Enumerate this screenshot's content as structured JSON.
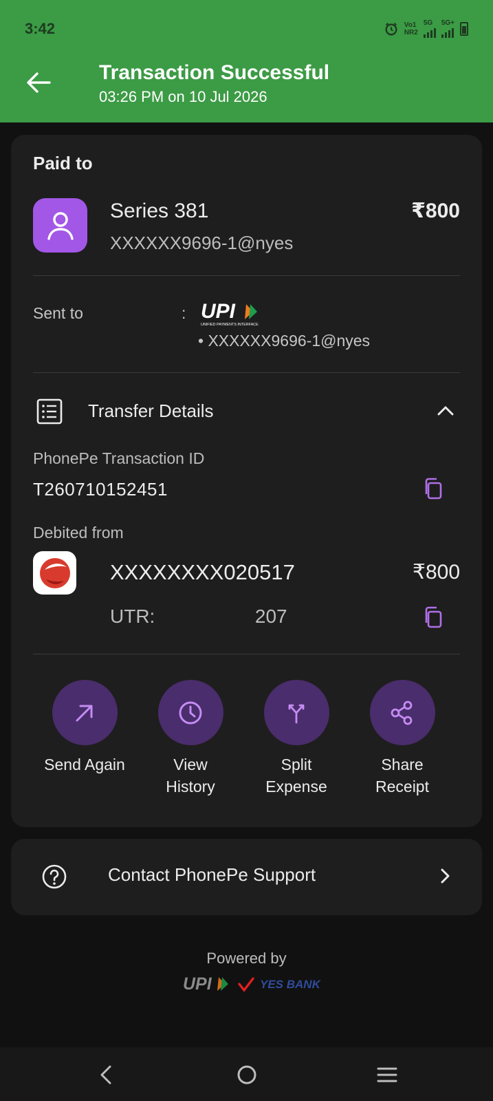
{
  "status_bar": {
    "time": "3:42",
    "network_1_top": "Vo1",
    "network_1_bottom": "NR2",
    "network_2": "5G",
    "network_3": "5G+"
  },
  "header": {
    "title": "Transaction Successful",
    "subtitle": "03:26 PM on 10 Jul 2026",
    "color": "#3c9b45"
  },
  "paid_to": {
    "label": "Paid to",
    "name": "Series 381",
    "upi_id": "XXXXXX9696-1@nyes",
    "amount": "₹800"
  },
  "sent_to": {
    "label": "Sent to",
    "colon": ":",
    "logo_text": "UPI",
    "logo_caption": "UNIFIED PAYMENTS INTERFACE",
    "upi_id": "• XXXXXX9696-1@nyes"
  },
  "transfer_details": {
    "title": "Transfer Details",
    "txid_label": "PhonePe Transaction ID",
    "txid_value": "T260710152451",
    "debited_label": "Debited from",
    "account": "XXXXXXXX020517",
    "amount": "₹800",
    "utr_label": "UTR:",
    "utr_value": "207"
  },
  "actions": [
    {
      "label_line1": "Send Again",
      "label_line2": "",
      "icon": "arrow-up-right-icon"
    },
    {
      "label_line1": "View",
      "label_line2": "History",
      "icon": "clock-icon"
    },
    {
      "label_line1": "Split",
      "label_line2": "Expense",
      "icon": "split-icon"
    },
    {
      "label_line1": "Share",
      "label_line2": "Receipt",
      "icon": "share-icon"
    }
  ],
  "support": {
    "label": "Contact PhonePe Support"
  },
  "footer": {
    "powered_by": "Powered by",
    "upi_logo": "UPI",
    "bank": "YES BANK"
  },
  "colors": {
    "accent_purple": "#a357e6",
    "action_circle": "#4a2d6c",
    "card": "#1e1e1e",
    "background": "#111111"
  }
}
